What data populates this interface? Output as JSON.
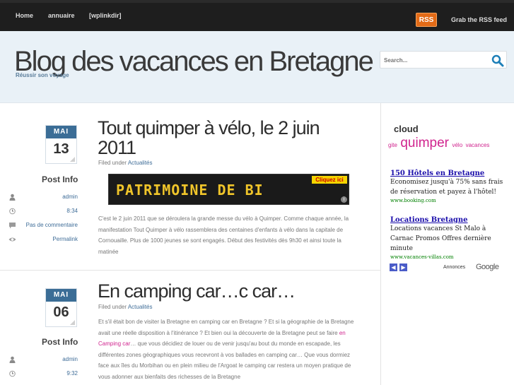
{
  "topbar": {
    "nav": [
      {
        "label": "Home"
      },
      {
        "label": "annuaire"
      },
      {
        "label": "[wplinkdir]"
      }
    ],
    "rss_badge": "RSS",
    "rss_feed_label": "Grab the RSS feed"
  },
  "header": {
    "title": "Blog des vacances en Bretagne",
    "tagline": "Réussir son voyage",
    "search_placeholder": "Search..."
  },
  "posts": [
    {
      "month": "MAI",
      "day": "13",
      "info_title": "Post Info",
      "info": {
        "author": "admin",
        "time": "8:34",
        "comments": "Pas de commentaire",
        "permalink": "Permalink"
      },
      "title_line1": "Tout quimper à vélo, le 2 juin",
      "title_line2": "2011",
      "filed_prefix": "Filed under",
      "category": "Actualités",
      "banner_text": "PATRIMOINE DE BI",
      "banner_button": "Cliquez ici",
      "banner_info": "i",
      "body": "C'est le 2 juin 2011 que se déroulera la grande messe du vélo à Quimper. Comme chaque année, la manifestation Tout Quimper à vélo rassemblera des centaines d'enfants à vélo dans la capitale de Cornouaille. Plus de 1000 jeunes se sont engagés. Début des festivités dès 9h30 et ainsi toute la matinée"
    },
    {
      "month": "MAI",
      "day": "06",
      "info_title": "Post Info",
      "info": {
        "author": "admin",
        "time": "9:32"
      },
      "title": "En camping car…c car…",
      "filed_prefix": "Filed under",
      "category": "Actualités",
      "body_part1": "Et s'il était bon de visiter la Bretagne en camping car en Bretagne ? Et si la géographie de la Bretagne avait une réelle disposition à l'itinérance ? Et bien oui la découverte de la Bretagne peut se faire ",
      "body_link": "en Camping car",
      "body_part2": "… que vous décidiez de louer ou de venir jusqu'au bout du monde en escapade, les différentes zones géographiques vous recevront à vos ballades en camping car… Que vous dormiez face aux îles du Morbihan ou en plein milieu de l'Argoat le camping car restera un moyen pratique de vous adonner aux bienfaits des richesses de la Bretagne"
    }
  ],
  "sidebar": {
    "cloud_title": "cloud",
    "tags": [
      {
        "label": "gite",
        "size": "small"
      },
      {
        "label": "quimper",
        "size": "big"
      },
      {
        "label": "vélo",
        "size": "small"
      },
      {
        "label": "vacances",
        "size": "small"
      }
    ],
    "ads": [
      {
        "title": "150 Hôtels en Bretagne",
        "desc": "Economisez jusqu'à 75% sans frais de réservation et payez à l'hôtel!",
        "url": "www.booking.com"
      },
      {
        "title": "Locations Bretagne",
        "desc": "Locations vacances St Malo à Carnac Promos Offres dernière minute",
        "url": "www.vacances-villas.com"
      }
    ],
    "ads_prev": "◀",
    "ads_next": "▶",
    "ads_label": "Annonces",
    "ads_brand": "Google"
  },
  "colors": {
    "topbar": "#1e1e1e",
    "header_bg": "#e9f1f7",
    "calendar_month": "#3b6d96",
    "link_blue": "#3f6d98",
    "tag_pink": "#d0248e",
    "rss_orange": "#e36b17"
  }
}
